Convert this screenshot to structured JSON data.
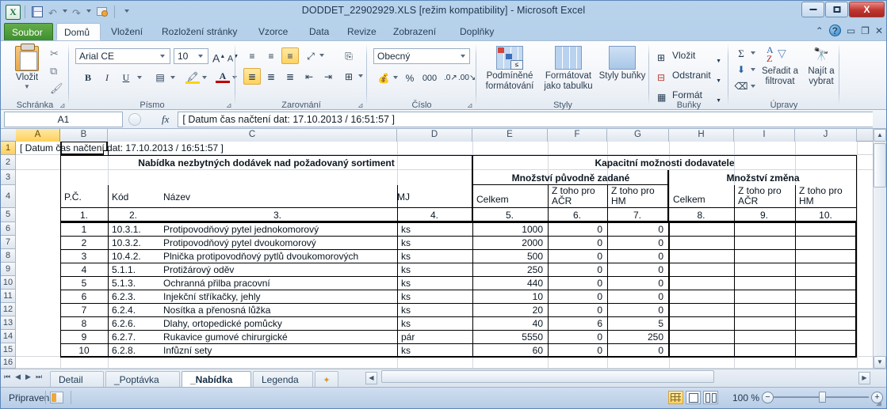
{
  "window": {
    "title": "DODDET_22902929.XLS  [režim kompatibility]  -  Microsoft Excel",
    "minimize_label": "—",
    "maximize_label": "□",
    "close_label": "X"
  },
  "quick_access": {
    "logo": "X",
    "save": "save-icon",
    "undo": "undo-icon",
    "redo": "redo-icon",
    "print_preview": "print-preview-icon",
    "customize": "customize-icon"
  },
  "ribbon": {
    "tabs": [
      {
        "label": "Soubor",
        "type": "file"
      },
      {
        "label": "Domů",
        "type": "active"
      },
      {
        "label": "Vložení",
        "type": "normal"
      },
      {
        "label": "Rozložení stránky",
        "type": "normal"
      },
      {
        "label": "Vzorce",
        "type": "normal"
      },
      {
        "label": "Data",
        "type": "normal"
      },
      {
        "label": "Revize",
        "type": "normal"
      },
      {
        "label": "Zobrazení",
        "type": "normal"
      },
      {
        "label": "Doplňky",
        "type": "normal"
      }
    ],
    "help": "?",
    "groups": {
      "clipboard": {
        "label": "Schránka",
        "paste": "Vložit",
        "cut": "cut-icon",
        "copy": "copy-icon",
        "format_painter": "format-painter-icon"
      },
      "font": {
        "label": "Písmo",
        "font_name": "Arial CE",
        "font_size": "10",
        "grow": "A",
        "shrink": "A",
        "bold": "B",
        "italic": "I",
        "underline": "U",
        "borders": "borders-icon",
        "fill": "fill-color-icon",
        "color": "font-color-icon"
      },
      "alignment": {
        "label": "Zarovnání",
        "top": "align-top-icon",
        "middle": "align-middle-icon",
        "bottom": "align-bottom-icon",
        "orientation": "orientation-icon",
        "left": "align-left-icon",
        "center": "align-center-icon",
        "right": "align-right-icon",
        "decrease_indent": "decrease-indent-icon",
        "increase_indent": "increase-indent-icon",
        "wrap": "wrap-text-icon",
        "merge": "merge-cells-icon"
      },
      "number": {
        "label": "Číslo",
        "format": "Obecný",
        "currency": "currency-icon",
        "percent": "%",
        "thousands": "000",
        "increase_decimal": "increase-decimal-icon",
        "decrease_decimal": "decrease-decimal-icon"
      },
      "styles": {
        "label": "Styly",
        "conditional": "Podmíněné formátování",
        "as_table": "Formátovat jako tabulku",
        "cell_styles": "Styly buňky"
      },
      "cells": {
        "label": "Buňky",
        "insert": "Vložit",
        "delete": "Odstranit",
        "format": "Formát"
      },
      "editing": {
        "label": "Úpravy",
        "autosum": "Σ",
        "fill": "fill-down-icon",
        "clear": "clear-icon",
        "sort_filter": "Seřadit a filtrovat",
        "find_select": "Najít a vybrat"
      }
    }
  },
  "formula_bar": {
    "name_box": "A1",
    "fx": "fx",
    "formula": "[ Datum čas načtení dat: 17.10.2013 / 16:51:57 ]"
  },
  "sheet": {
    "columns": [
      "A",
      "B",
      "C",
      "D",
      "E",
      "F",
      "G",
      "H",
      "I",
      "J"
    ],
    "selected_column": "A",
    "rows": [
      "1",
      "2",
      "3",
      "4",
      "5",
      "6",
      "7",
      "8",
      "9",
      "10",
      "11",
      "12",
      "13",
      "14",
      "15",
      "16"
    ],
    "selected_row": "1",
    "active_cell": "A1",
    "a1_text": "[ Datum čas načtení dat: 17.10.2013 / 16:51:57 ]",
    "header_left_title": "Nabídka nezbytných dodávek nad požadovaný sortiment",
    "header_right_title": "Kapacitní možnosti dodavatele",
    "header_group_original": "Množství původně zadané",
    "header_group_change": "Množství změna",
    "col_headers": {
      "pc": "P.Č.",
      "kod": "Kód",
      "nazev": "Název",
      "mj": "MJ",
      "celkem1": "Celkem",
      "acr1": "Z toho pro AČR",
      "hm1": "Z toho pro HM",
      "celkem2": "Celkem",
      "acr2": "Z toho pro AČR",
      "hm2": "Z toho pro HM"
    },
    "number_row": [
      "1.",
      "2.",
      "3.",
      "4.",
      "5.",
      "6.",
      "7.",
      "8.",
      "9.",
      "10."
    ],
    "data_rows": [
      {
        "excel_row": "6",
        "pc": "1",
        "kod": "10.3.1.",
        "nazev": "Protipovodňový pytel  jednokomorový",
        "mj": "ks",
        "celkem1": "1000",
        "acr1": "0",
        "hm1": "0",
        "celkem2": "",
        "acr2": "",
        "hm2": ""
      },
      {
        "excel_row": "7",
        "pc": "2",
        "kod": "10.3.2.",
        "nazev": "Protipovodňový pytel  dvoukomorový",
        "mj": "ks",
        "celkem1": "2000",
        "acr1": "0",
        "hm1": "0",
        "celkem2": "",
        "acr2": "",
        "hm2": ""
      },
      {
        "excel_row": "8",
        "pc": "3",
        "kod": "10.4.2.",
        "nazev": "Plnička protipovodňový pytlů  dvoukomorových",
        "mj": "ks",
        "celkem1": "500",
        "acr1": "0",
        "hm1": "0",
        "celkem2": "",
        "acr2": "",
        "hm2": ""
      },
      {
        "excel_row": "9",
        "pc": "4",
        "kod": "5.1.1.",
        "nazev": "Protižárový oděv",
        "mj": "ks",
        "celkem1": "250",
        "acr1": "0",
        "hm1": "0",
        "celkem2": "",
        "acr2": "",
        "hm2": ""
      },
      {
        "excel_row": "10",
        "pc": "5",
        "kod": "5.1.3.",
        "nazev": "Ochranná přilba pracovní",
        "mj": "ks",
        "celkem1": "440",
        "acr1": "0",
        "hm1": "0",
        "celkem2": "",
        "acr2": "",
        "hm2": ""
      },
      {
        "excel_row": "11",
        "pc": "6",
        "kod": "6.2.3.",
        "nazev": "Injekční stříkačky, jehly",
        "mj": "ks",
        "celkem1": "10",
        "acr1": "0",
        "hm1": "0",
        "celkem2": "",
        "acr2": "",
        "hm2": ""
      },
      {
        "excel_row": "12",
        "pc": "7",
        "kod": "6.2.4.",
        "nazev": "Nosítka a přenosná lůžka",
        "mj": "ks",
        "celkem1": "20",
        "acr1": "0",
        "hm1": "0",
        "celkem2": "",
        "acr2": "",
        "hm2": ""
      },
      {
        "excel_row": "13",
        "pc": "8",
        "kod": "6.2.6.",
        "nazev": "Dlahy, ortopedické pomůcky",
        "mj": "ks",
        "celkem1": "40",
        "acr1": "6",
        "hm1": "5",
        "celkem2": "",
        "acr2": "",
        "hm2": ""
      },
      {
        "excel_row": "14",
        "pc": "9",
        "kod": "6.2.7.",
        "nazev": "Rukavice gumové chirurgické",
        "mj": "pár",
        "celkem1": "5550",
        "acr1": "0",
        "hm1": "250",
        "celkem2": "",
        "acr2": "",
        "hm2": ""
      },
      {
        "excel_row": "15",
        "pc": "10",
        "kod": "6.2.8.",
        "nazev": "Infůzní sety",
        "mj": "ks",
        "celkem1": "60",
        "acr1": "0",
        "hm1": "0",
        "celkem2": "",
        "acr2": "",
        "hm2": ""
      }
    ]
  },
  "sheet_tabs": {
    "items": [
      {
        "label": "Detail",
        "active": false
      },
      {
        "label": "_Poptávka",
        "active": false
      },
      {
        "label": "_Nabídka",
        "active": true
      },
      {
        "label": "Legenda",
        "active": false
      }
    ],
    "new_sheet": "new-sheet-icon",
    "nav_first": "◀◀",
    "nav_prev": "◀",
    "nav_next": "▶",
    "nav_last": "▶▶"
  },
  "status_bar": {
    "status": "Připraven",
    "macro_record": "record-macro-icon",
    "view_normal": "normal-view-icon",
    "view_layout": "page-layout-view-icon",
    "view_break": "page-break-view-icon",
    "zoom": "100 %",
    "zoom_out": "−",
    "zoom_in": "+"
  }
}
